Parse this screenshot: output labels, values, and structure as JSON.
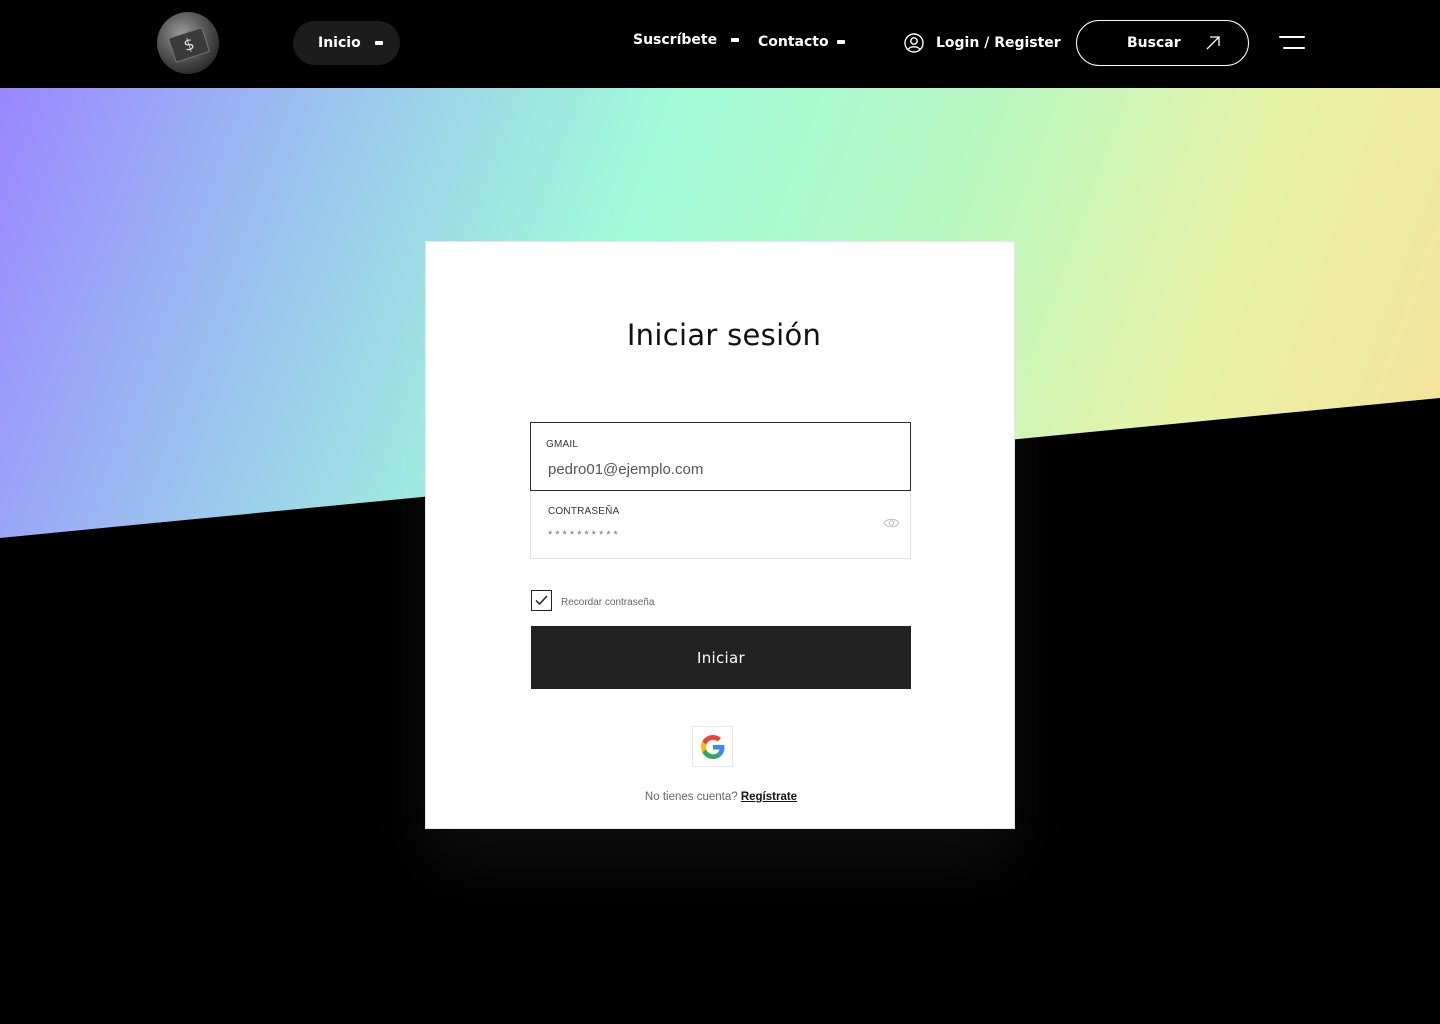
{
  "header": {
    "logo_alt": "logo",
    "nav": [
      {
        "label": "Inicio"
      },
      {
        "label": "Suscríbete"
      },
      {
        "label": "Contacto"
      }
    ],
    "login_label": "Login / Register",
    "search_label": "Buscar"
  },
  "login_card": {
    "title": "Iniciar sesión",
    "email": {
      "label": "GMAIL",
      "value": "pedro01@ejemplo.com"
    },
    "password": {
      "label": "CONTRASEÑA",
      "value": "**********"
    },
    "remember_label": "Recordar contraseña",
    "remember_checked": true,
    "submit_label": "Iniciar",
    "signup_prompt": "No tienes cuenta?",
    "signup_link": "Regístrate"
  },
  "colors": {
    "background": "#000000",
    "card": "#ffffff",
    "button": "#222222",
    "gradient": [
      "#9a87ff",
      "#9bc7ee",
      "#a0fbd9",
      "#b8f8c1",
      "#e6f3a8",
      "#f8e199"
    ]
  },
  "icons": [
    "user-icon",
    "arrow-up-right-icon",
    "menu-icon",
    "eye-icon",
    "check-icon",
    "google-icon"
  ]
}
